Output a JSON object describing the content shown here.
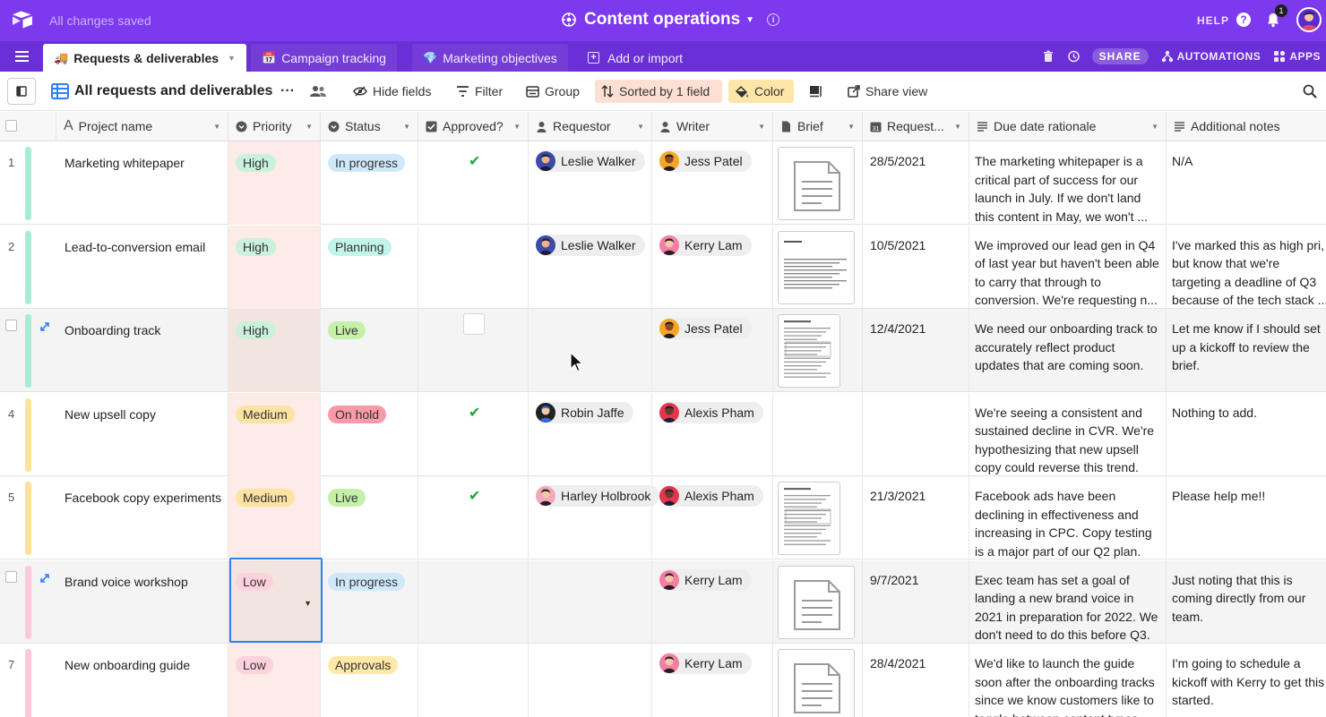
{
  "topbar": {
    "saved": "All changes saved",
    "base_title": "Content operations",
    "help": "HELP",
    "notifications_count": "1",
    "colors": {
      "bg": "#7c39ed",
      "tabbar": "#6a2fd6"
    }
  },
  "tabs": [
    {
      "label": "Requests & deliverables",
      "emoji": "🚚",
      "active": true
    },
    {
      "label": "Campaign tracking",
      "emoji": "📅",
      "active": false
    },
    {
      "label": "Marketing objectives",
      "emoji": "💎",
      "active": false
    },
    {
      "label": "Add or import",
      "active": false
    }
  ],
  "header_tools": {
    "share": "SHARE",
    "automations": "AUTOMATIONS",
    "apps": "APPS"
  },
  "toolbar": {
    "view_name": "All requests and deliverables",
    "hide_fields": "Hide fields",
    "filter": "Filter",
    "group": "Group",
    "sorted": "Sorted by 1 field",
    "color": "Color",
    "share_view": "Share view"
  },
  "columns": {
    "project": "Project name",
    "priority": "Priority",
    "status": "Status",
    "approved": "Approved?",
    "requestor": "Requestor",
    "writer": "Writer",
    "brief": "Brief",
    "request_date": "Request...",
    "rationale": "Due date rationale",
    "notes": "Additional notes"
  },
  "rows": [
    {
      "num": "1",
      "name": "Marketing whitepaper",
      "priority": "High",
      "status": "In progress",
      "approved": true,
      "requestor": "Leslie Walker",
      "writer": "Jess Patel",
      "date": "28/5/2021",
      "rationale": "The marketing whitepaper is a critical part of success for our launch in July. If we don't land this content in May, we won't ...",
      "notes": "N/A"
    },
    {
      "num": "2",
      "name": "Lead-to-conversion email",
      "priority": "High",
      "status": "Planning",
      "approved": false,
      "requestor": "Leslie Walker",
      "writer": "Kerry Lam",
      "date": "10/5/2021",
      "rationale": "We improved our lead gen in Q4 of last year but haven't been able to carry that through to conversion. We're requesting n...",
      "notes": "I've marked this as high pri, but know that we're targeting a deadline of Q3 because of the tech stack ..."
    },
    {
      "num": "",
      "name": "Onboarding track",
      "priority": "High",
      "status": "Live",
      "approved": false,
      "requestor": "",
      "writer": "Jess Patel",
      "date": "12/4/2021",
      "rationale": "We need our onboarding track to accurately reflect product updates that are coming soon.",
      "notes": "Let me know if I should set up a kickoff to review the brief."
    },
    {
      "num": "4",
      "name": "New upsell copy",
      "priority": "Medium",
      "status": "On hold",
      "approved": true,
      "requestor": "Robin Jaffe",
      "writer": "Alexis Pham",
      "date": "",
      "rationale": "We're seeing a consistent and sustained decline in CVR. We're hypothesizing that new upsell copy could reverse this trend.",
      "notes": "Nothing to add."
    },
    {
      "num": "5",
      "name": "Facebook copy experiments",
      "priority": "Medium",
      "status": "Live",
      "approved": true,
      "requestor": "Harley Holbrook",
      "writer": "Alexis Pham",
      "date": "21/3/2021",
      "rationale": "Facebook ads have been declining in effectiveness and increasing in CPC. Copy testing is a major part of our Q2 plan.",
      "notes": "Please help me!!"
    },
    {
      "num": "",
      "name": "Brand voice workshop",
      "priority": "Low",
      "status": "In progress",
      "approved": false,
      "requestor": "",
      "writer": "Kerry Lam",
      "date": "9/7/2021",
      "rationale": "Exec team has set a goal of landing a new brand voice in 2021 in preparation for 2022. We don't need to do this before Q3.",
      "notes": "Just noting that this is coming directly from our team."
    },
    {
      "num": "7",
      "name": "New onboarding guide",
      "priority": "Low",
      "status": "Approvals",
      "approved": false,
      "requestor": "",
      "writer": "Kerry Lam",
      "date": "28/4/2021",
      "rationale": "We'd like to launch the guide soon after the onboarding tracks since we know customers like to toggle between content types.",
      "notes": "I'm going to schedule a kickoff with Kerry to get this started."
    }
  ]
}
